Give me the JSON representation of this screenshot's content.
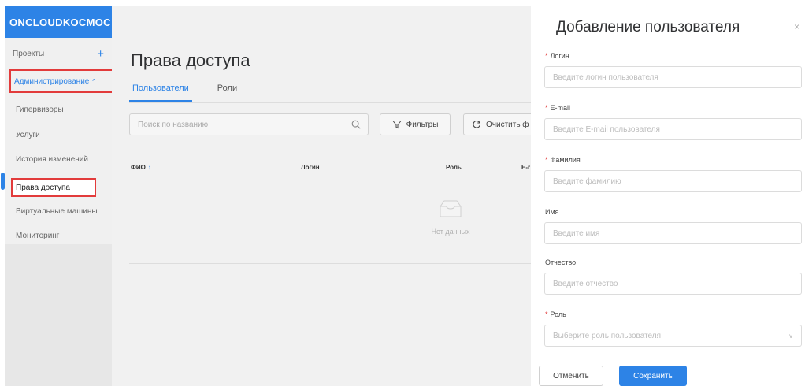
{
  "sidebar": {
    "logo": "ONCLOUDKOCMOC",
    "projects_label": "Проекты",
    "projects_add": "+",
    "admin_label": "Администрирование",
    "admin_caret": "^",
    "items": [
      {
        "label": "Гипервизоры"
      },
      {
        "label": "Услуги"
      },
      {
        "label": "История изменений"
      },
      {
        "label": "Права доступа"
      },
      {
        "label": "Виртуальные машины"
      },
      {
        "label": "Мониторинг"
      }
    ]
  },
  "main": {
    "title": "Права доступа",
    "tabs": [
      {
        "label": "Пользователи"
      },
      {
        "label": "Роли"
      }
    ],
    "search_placeholder": "Поиск по названию",
    "filter_label": "Фильтры",
    "clear_label": "Очистить ф",
    "columns": [
      {
        "label": "ФИО"
      },
      {
        "label": "Логин"
      },
      {
        "label": "Роль"
      },
      {
        "label": "E-r"
      }
    ],
    "empty_text": "Нет данных"
  },
  "drawer": {
    "title": "Добавление пользователя",
    "close": "×",
    "required_mark": "*",
    "fields": [
      {
        "label": "Логин",
        "placeholder": "Введите логин пользователя"
      },
      {
        "label": "E-mail",
        "placeholder": "Введите E-mail пользователя"
      },
      {
        "label": "Фамилия",
        "placeholder": "Введите фамилию"
      },
      {
        "label": "Имя",
        "placeholder": "Введите имя"
      },
      {
        "label": "Отчество",
        "placeholder": "Введите отчество"
      },
      {
        "label": "Роль",
        "placeholder": "Выберите роль пользователя"
      }
    ],
    "cancel_label": "Отменить",
    "save_label": "Сохранить"
  },
  "colors": {
    "accent": "#2d83e6",
    "highlight_border": "#e23b3b"
  }
}
